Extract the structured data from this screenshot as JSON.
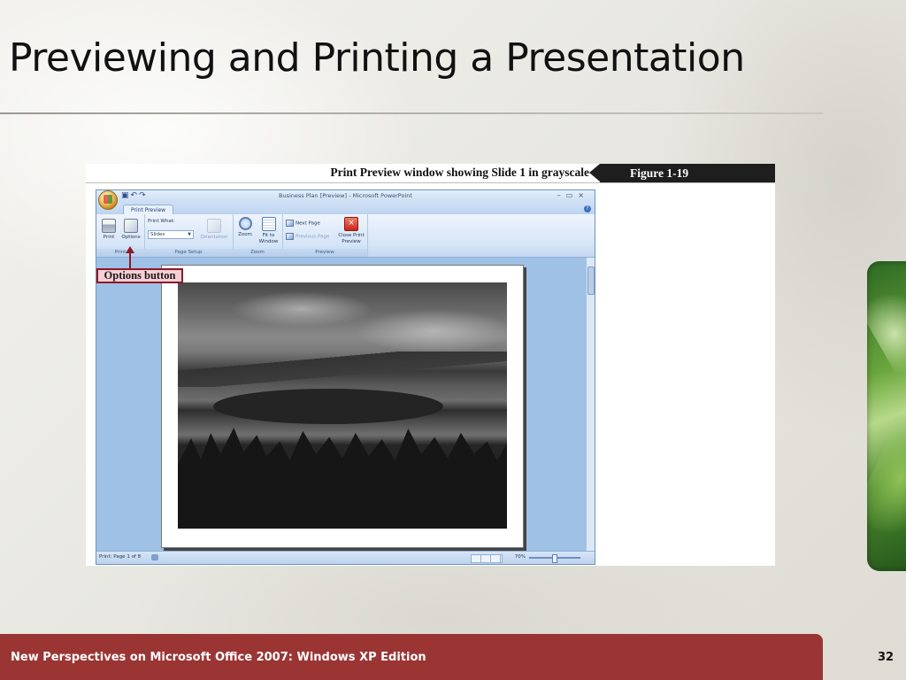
{
  "slide": {
    "title": "Previewing and Printing a Presentation",
    "footer": "New Perspectives on Microsoft Office 2007: Windows XP Edition",
    "page_number": "32"
  },
  "figure": {
    "caption": "Print Preview window showing Slide 1 in grayscale",
    "number": "Figure  1-19",
    "callout": "Options button"
  },
  "window": {
    "title": "Business Plan [Preview] - Microsoft PowerPoint",
    "tab_active": "Print Preview",
    "controls": [
      "–",
      "▭",
      "×"
    ]
  },
  "ribbon": {
    "groups": {
      "print": "Print",
      "page_setup": "Page Setup",
      "zoom": "Zoom",
      "preview": "Preview"
    },
    "buttons": {
      "print": "Print",
      "options": "Options",
      "print_what_label": "Print What:",
      "print_what_value": "Slides",
      "orientation": "Orientation",
      "zoom": "Zoom",
      "fit_to_window_line1": "Fit to",
      "fit_to_window_line2": "Window",
      "next_page": "Next Page",
      "previous_page": "Previous Page",
      "close_preview_line1": "Close Print",
      "close_preview_line2": "Preview"
    }
  },
  "status_bar": {
    "page_info": "Print: Page 1 of 8",
    "zoom_percent": "70%"
  },
  "icons": {
    "office": "office-button-icon",
    "save": "save-icon",
    "undo": "undo-icon",
    "help": "help-icon"
  },
  "colors": {
    "footer_bg": "#9b3534",
    "figure_number_bg": "#1e1e1e",
    "callout_border": "#8a1a2a",
    "callout_fill": "#f6cfd4",
    "ribbon_blue": "#a8c8ea"
  }
}
